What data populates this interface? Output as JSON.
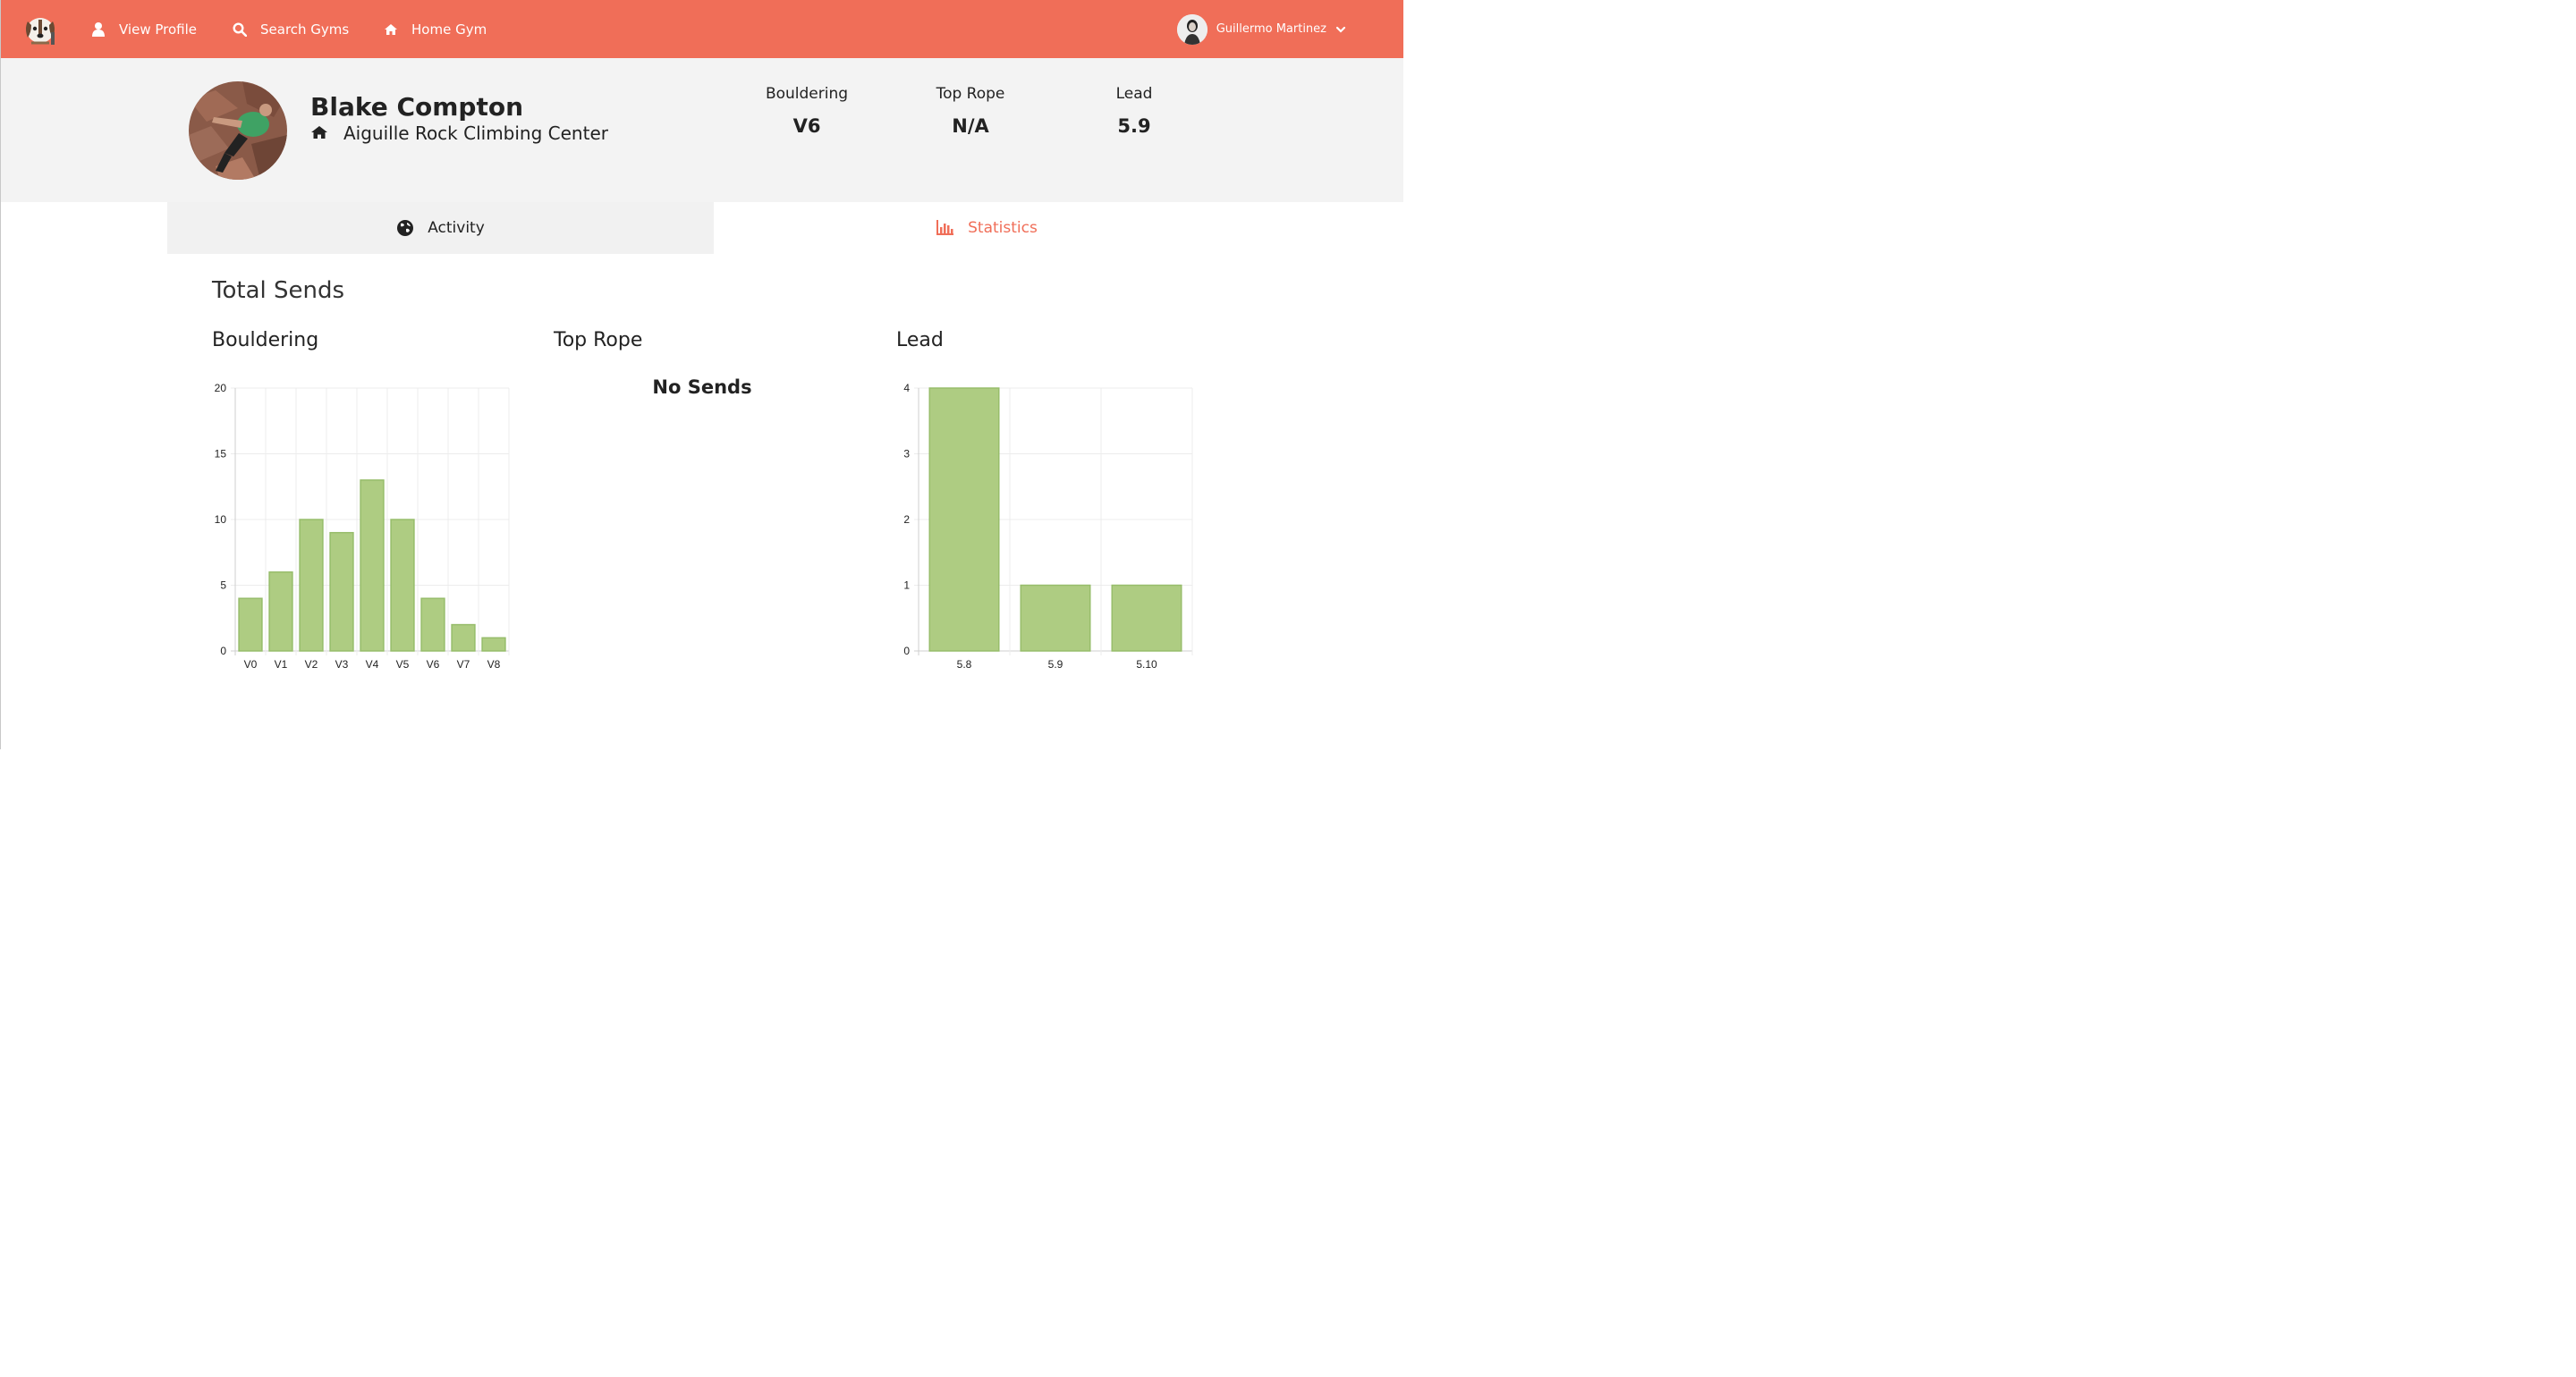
{
  "nav": {
    "logo_icon": "dog-logo-icon",
    "items": [
      {
        "label": "View Profile",
        "icon": "user-icon"
      },
      {
        "label": "Search Gyms",
        "icon": "search-icon"
      },
      {
        "label": "Home Gym",
        "icon": "home-icon"
      }
    ],
    "user": {
      "name": "Guillermo Martinez",
      "icon": "chevron-down-icon"
    }
  },
  "profile": {
    "name": "Blake Compton",
    "home_gym": "Aiguille Rock Climbing Center",
    "grades": [
      {
        "label": "Bouldering",
        "value": "V6"
      },
      {
        "label": "Top Rope",
        "value": "N/A"
      },
      {
        "label": "Lead",
        "value": "5.9"
      }
    ]
  },
  "tabs": [
    {
      "label": "Activity",
      "icon": "globe-icon",
      "active": false
    },
    {
      "label": "Statistics",
      "icon": "bar-chart-icon",
      "active": true
    }
  ],
  "stats": {
    "section_title": "Total Sends",
    "charts_titles": [
      "Bouldering",
      "Top Rope",
      "Lead"
    ],
    "empty_message": "No Sends"
  },
  "colors": {
    "accent": "#f06e58",
    "bar_fill": "#aecc82",
    "bar_stroke": "#97bd6b"
  },
  "chart_data": [
    {
      "type": "bar",
      "title": "Bouldering",
      "categories": [
        "V0",
        "V1",
        "V2",
        "V3",
        "V4",
        "V5",
        "V6",
        "V7",
        "V8"
      ],
      "values": [
        4,
        6,
        10,
        9,
        13,
        10,
        4,
        2,
        1
      ],
      "ylim": [
        0,
        20
      ],
      "yticks": [
        0,
        5,
        10,
        15,
        20
      ],
      "grid": true
    },
    {
      "type": "bar",
      "title": "Lead",
      "categories": [
        "5.8",
        "5.9",
        "5.10"
      ],
      "values": [
        4,
        1,
        1
      ],
      "ylim": [
        0,
        4
      ],
      "yticks": [
        0,
        1,
        2,
        3,
        4
      ],
      "grid": true
    }
  ]
}
